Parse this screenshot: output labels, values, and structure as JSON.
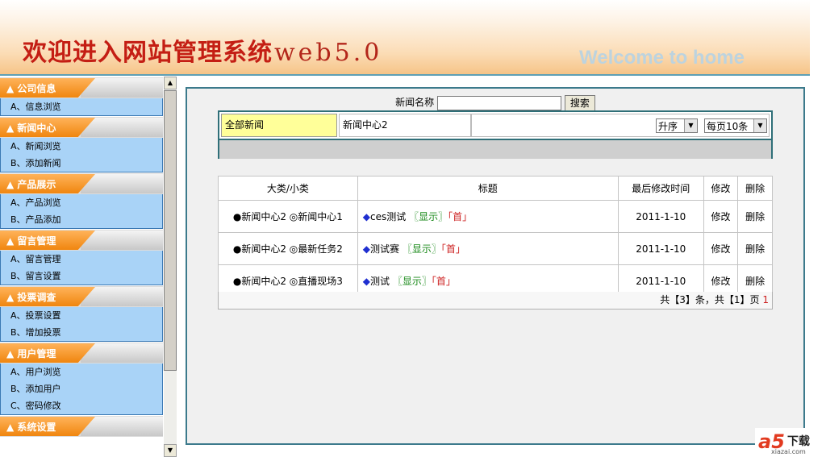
{
  "header": {
    "title": "欢迎进入网站管理系统",
    "version": "web5.0",
    "welcome": "Welcome to home"
  },
  "sidebar": {
    "sections": [
      {
        "title": "▲ 公司信息",
        "items": [
          "A、信息浏览"
        ]
      },
      {
        "title": "▲ 新闻中心",
        "items": [
          "A、新闻浏览",
          "B、添加新闻"
        ]
      },
      {
        "title": "▲ 产品展示",
        "items": [
          "A、产品浏览",
          "B、产品添加"
        ]
      },
      {
        "title": "▲ 留言管理",
        "items": [
          "A、留言管理",
          "B、留言设置"
        ]
      },
      {
        "title": "▲ 投票调查",
        "items": [
          "A、投票设置",
          "B、增加投票"
        ]
      },
      {
        "title": "▲ 用户管理",
        "items": [
          "A、用户浏览",
          "B、添加用户",
          "C、密码修改"
        ]
      },
      {
        "title": "▲ 系统设置",
        "items": []
      }
    ]
  },
  "search": {
    "label": "新闻名称",
    "value": "",
    "button": "搜索"
  },
  "filter": {
    "all_label": "全部新闻",
    "category": "新闻中心2",
    "sort": "升序",
    "per_page": "每页10条"
  },
  "table": {
    "headers": [
      "大类/小类",
      "标题",
      "最后修改时间",
      "修改",
      "删除"
    ],
    "rows": [
      {
        "category": "●新闻中心2 ◎新闻中心1",
        "title": "ces测试",
        "show": "〖显示〗",
        "first": "「首」",
        "date": "2011-1-10",
        "edit": "修改",
        "delete": "删除"
      },
      {
        "category": "●新闻中心2 ◎最新任务2",
        "title": "测试赛",
        "show": "〖显示〗",
        "first": "「首」",
        "date": "2011-1-10",
        "edit": "修改",
        "delete": "删除"
      },
      {
        "category": "●新闻中心2 ◎直播现场3",
        "title": "测试",
        "show": "〖显示〗",
        "first": "「首」",
        "date": "2011-1-10",
        "edit": "修改",
        "delete": "删除"
      }
    ]
  },
  "pager": {
    "text": "共【3】条，共【1】页",
    "page": "1"
  },
  "watermark": {
    "logo": "a5",
    "text": "下载",
    "sub": "xiazai.com"
  },
  "colors": {
    "title_red": "#c41e14",
    "tab_orange": "#f0860f",
    "menu_blue": "#a9d3f7",
    "border_teal": "#2f6f78"
  }
}
